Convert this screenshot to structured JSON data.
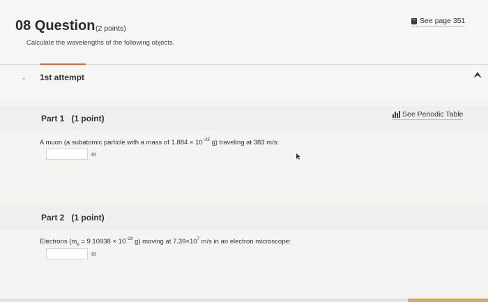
{
  "header": {
    "question_title": "08 Question",
    "question_points": "(2 points)",
    "see_page_label": "See page 351",
    "instruction": "Calculate the wavelengths of the following objects."
  },
  "attempt": {
    "label": "1st attempt"
  },
  "parts": [
    {
      "title": "Part 1   (1 point)",
      "prompt_before": "A muon (a subatomic particle with a mass of 1.884 × 10",
      "prompt_exp": "−25",
      "prompt_after": " g) traveling at 383 m/s:",
      "unit": "m",
      "answer_value": ""
    },
    {
      "title": "Part 2   (1 point)",
      "prompt_before": "Electrons (m",
      "prompt_sub": "e",
      "prompt_mid": " = 9.10938 × 10",
      "prompt_exp": "−28",
      "prompt_mid2": " g) moving at 7.39×10",
      "prompt_exp2": "7",
      "prompt_after": " m/s in an electron microscope:",
      "unit": "m",
      "answer_value": ""
    }
  ],
  "periodic_table_label": "See Periodic Table",
  "colors": {
    "accent": "#d3634b",
    "bottom_accent": "#d8a56a"
  }
}
